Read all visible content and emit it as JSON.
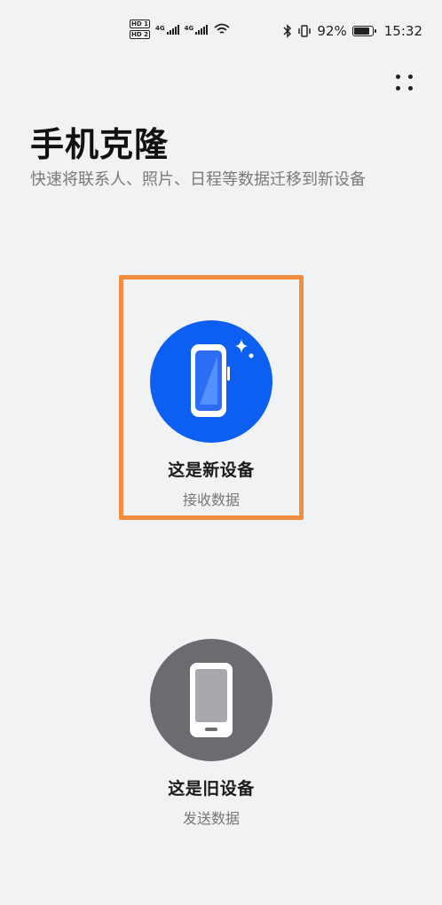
{
  "status_bar": {
    "hd_top": "HD 1",
    "hd_bottom": "HD 2",
    "net1": "4G",
    "net2": "4G",
    "battery_percent": "92%",
    "battery_level": 0.92,
    "time": "15:32",
    "icons": [
      "hd-icon",
      "signal-icon",
      "signal-icon",
      "wifi-icon",
      "bluetooth-icon",
      "vibrate-icon",
      "battery-icon"
    ]
  },
  "header": {
    "title": "手机克隆",
    "subtitle": "快速将联系人、照片、日程等数据迁移到新设备",
    "menu_icon": "more-icon"
  },
  "options": {
    "new": {
      "title": "这是新设备",
      "subtitle": "接收数据",
      "icon": "new-phone-icon",
      "circle_color": "#0d5ff1",
      "selected": true,
      "highlight_color": "#f58d3c"
    },
    "old": {
      "title": "这是旧设备",
      "subtitle": "发送数据",
      "icon": "old-phone-icon",
      "circle_color": "#6b6c70"
    }
  }
}
